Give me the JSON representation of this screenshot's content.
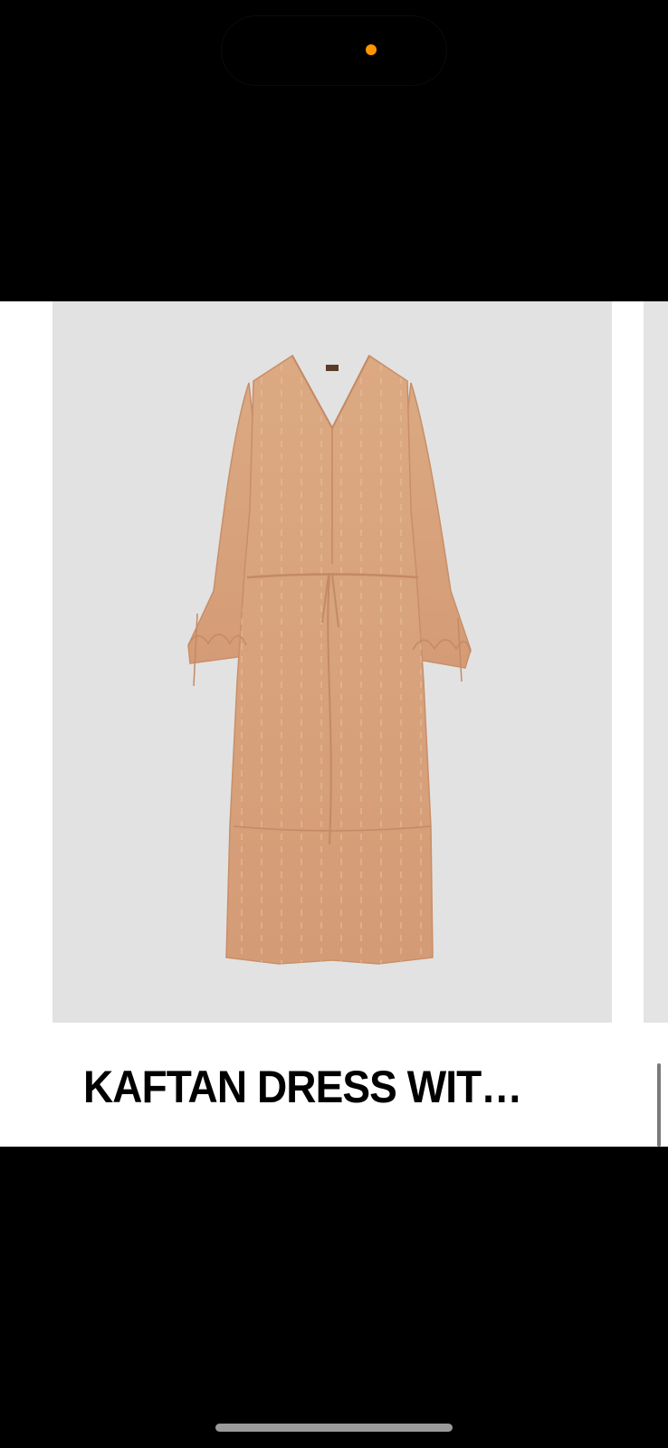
{
  "product": {
    "title": "KAFTAN DRESS WIT…",
    "image_description": "dress-photo",
    "garment_color": "#d9a37e",
    "background_color": "#e2e2e2"
  },
  "system": {
    "camera_indicator_color": "#ff9500"
  }
}
